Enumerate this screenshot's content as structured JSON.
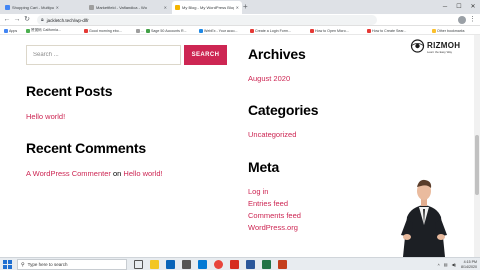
{
  "browser": {
    "tabs": [
      {
        "label": "Shopping Cart - Multipurpose",
        "favicon_color": "#4285f4",
        "active": false
      },
      {
        "label": "Marketfield - Vaflandica - Wo",
        "favicon_color": "#9e9e9e",
        "active": false
      },
      {
        "label": "My Blog - My WordPress Blog",
        "favicon_color": "#f4b400",
        "active": true
      }
    ],
    "url": "jackletch.tech/wp-dlfr",
    "bookmarks": [
      {
        "label": "Apps",
        "color": "#4285f4"
      },
      {
        "label": "赞赏码 California...",
        "color": "#4caf50"
      },
      {
        "label": "Good morning ebo...",
        "color": "#e53935"
      },
      {
        "label": "...",
        "color": "#9e9e9e"
      },
      {
        "label": "Sage 50 Accounts R...",
        "color": "#43a047"
      },
      {
        "label": "WebEx - Your acco...",
        "color": "#1e88e5"
      },
      {
        "label": "Create a Login Form...",
        "color": "#e53935"
      },
      {
        "label": "How to Open Micro...",
        "color": "#e53935"
      },
      {
        "label": "How to Create Sear...",
        "color": "#e53935"
      },
      {
        "label": "Other bookmarks",
        "color": "#fbc02d"
      }
    ]
  },
  "page": {
    "search": {
      "placeholder": "Search ...",
      "button_label": "SEARCH"
    },
    "recent_posts": {
      "title": "Recent Posts",
      "items": [
        "Hello world!"
      ]
    },
    "recent_comments": {
      "title": "Recent Comments",
      "author": "A WordPress Commenter",
      "connector": "on",
      "post": "Hello world!"
    },
    "archives": {
      "title": "Archives",
      "items": [
        "August 2020"
      ]
    },
    "categories": {
      "title": "Categories",
      "items": [
        "Uncategorized"
      ]
    },
    "meta": {
      "title": "Meta",
      "items": [
        "Log in",
        "Entries feed",
        "Comments feed",
        "WordPress.org"
      ]
    },
    "accent_color": "#cd2653"
  },
  "overlay": {
    "brand": "RIZMOH",
    "brand_sub": "Learn the Easy Way"
  },
  "taskbar": {
    "search_placeholder": "Type here to search",
    "time": "4:15 PM",
    "date": "8/14/2020"
  }
}
